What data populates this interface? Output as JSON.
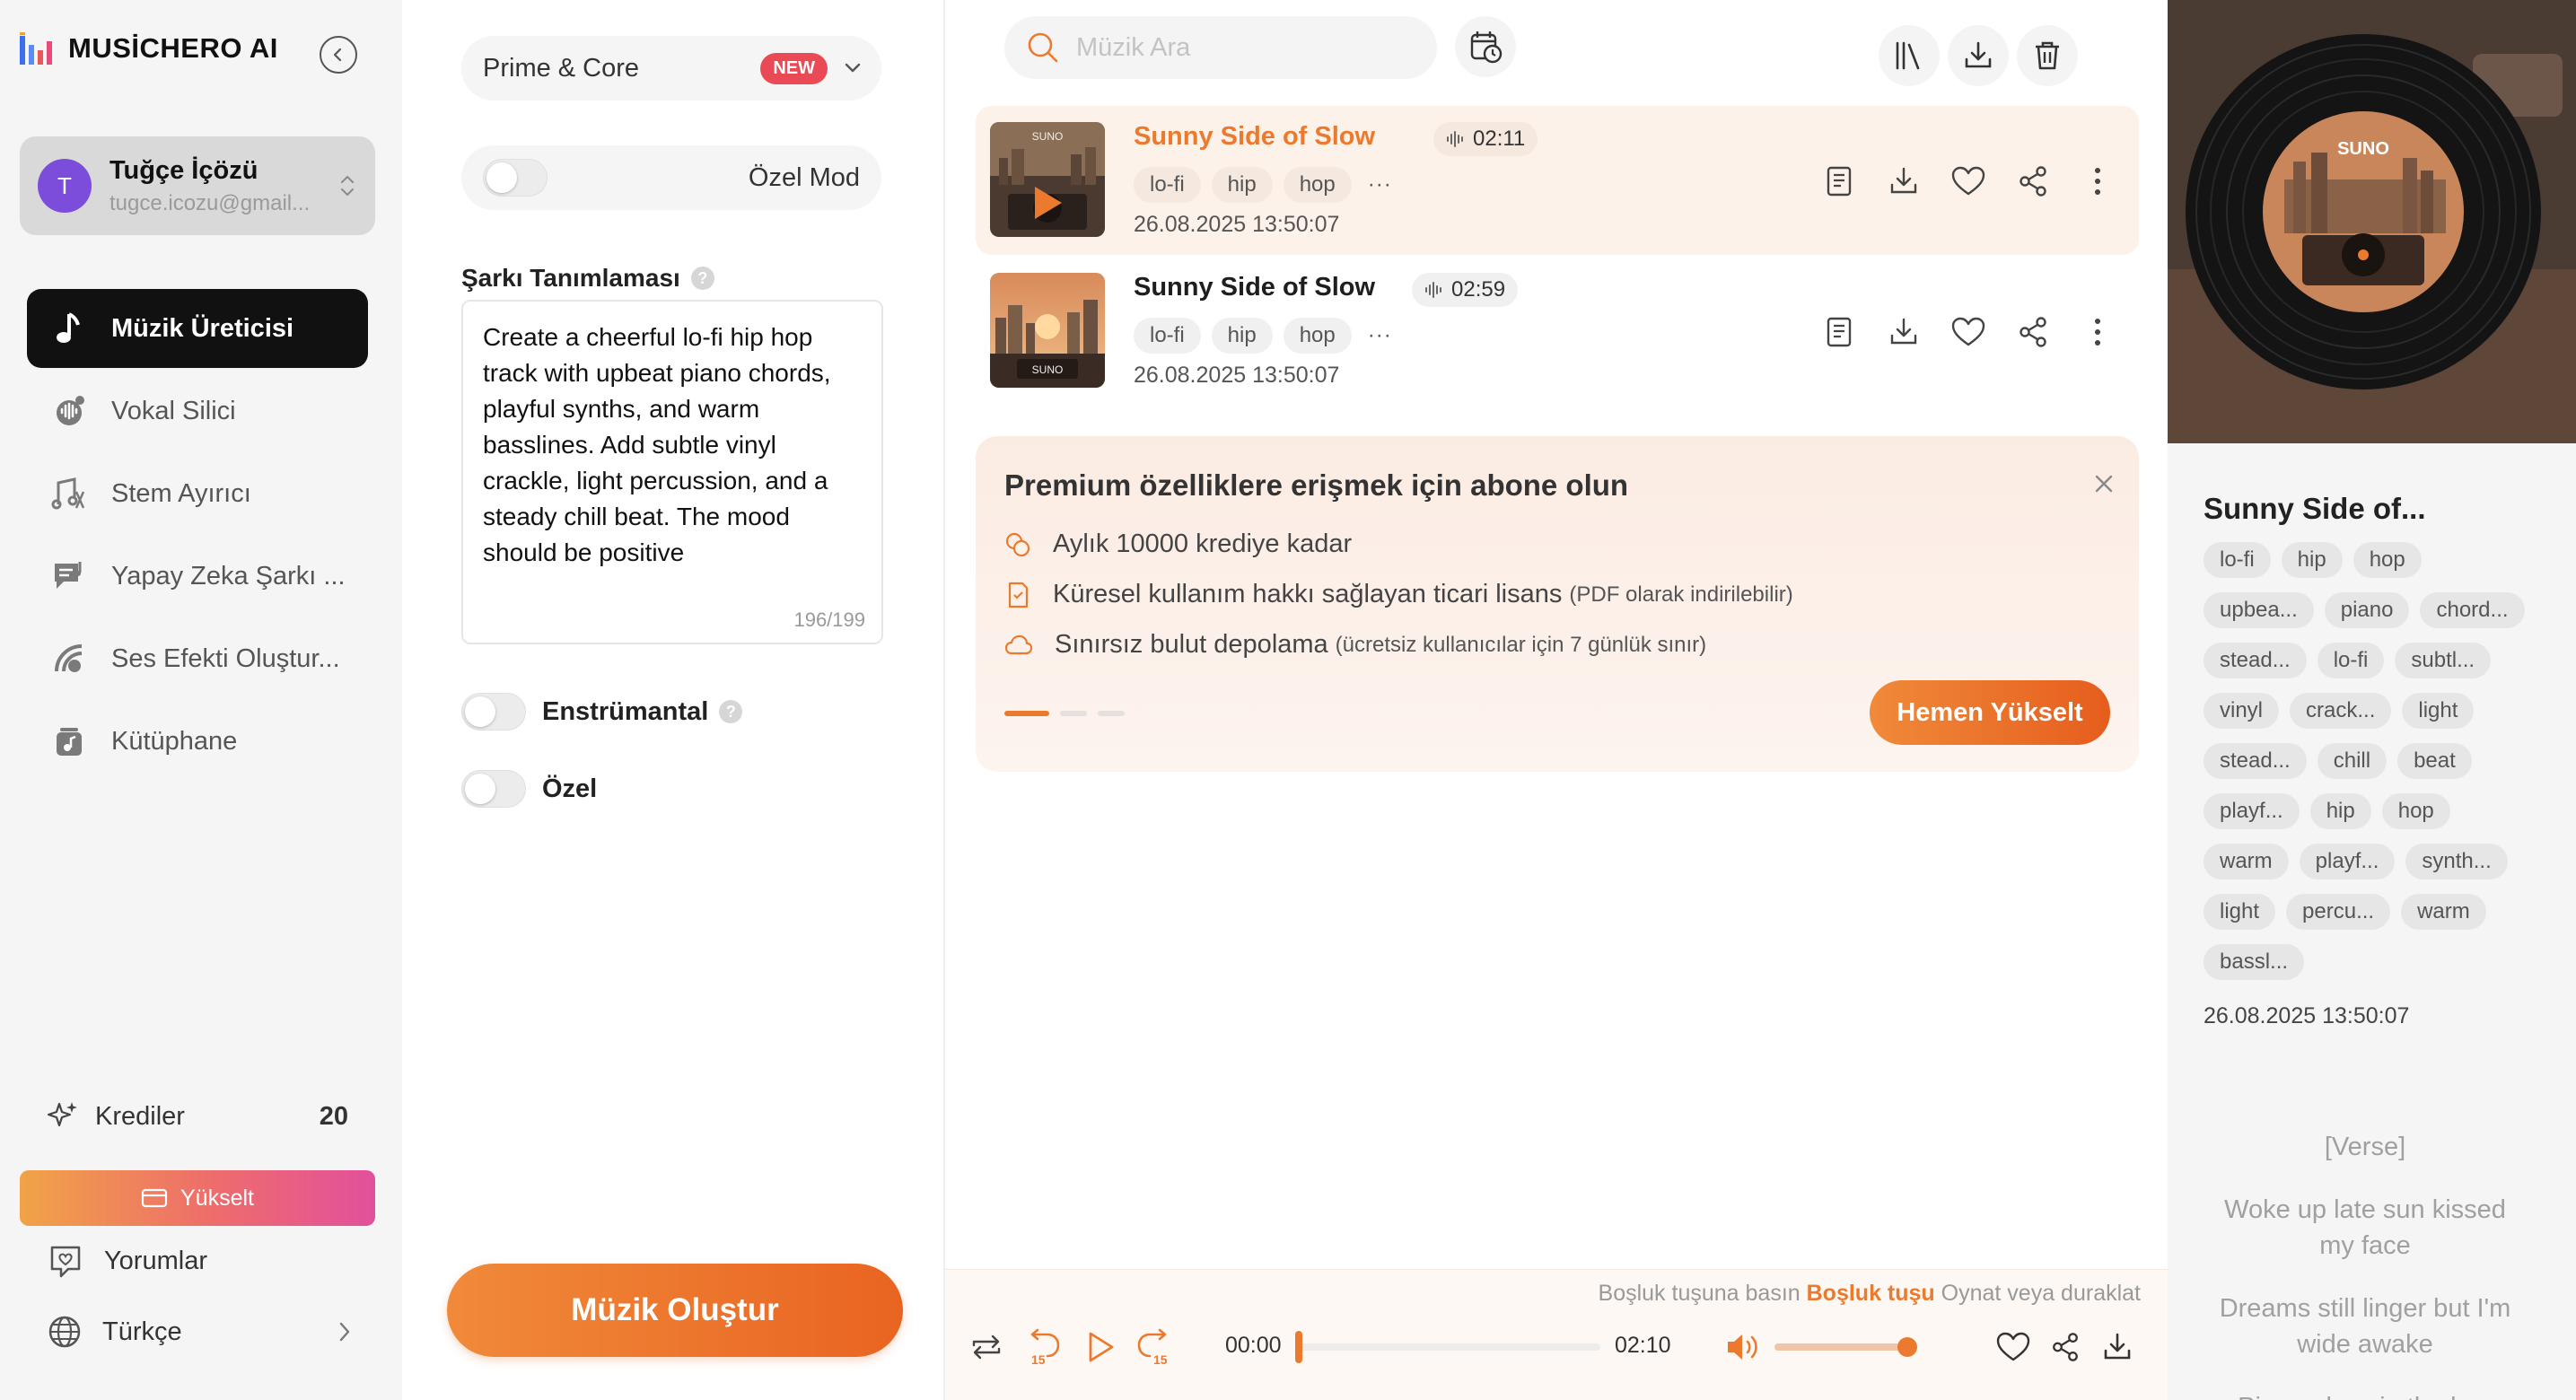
{
  "app": {
    "logo_text": "MUSİCHERO AI",
    "colors": {
      "accent": "#ec7a2e",
      "active_nav": "#111111",
      "badge_new": "#ea4a55"
    }
  },
  "user": {
    "initial": "T",
    "name": "Tuğçe İçözü",
    "email": "tugce.icozu@gmail..."
  },
  "nav": [
    {
      "label": "Müzik Üreticisi",
      "icon": "music-note-icon",
      "active": true
    },
    {
      "label": "Vokal Silici",
      "icon": "vocal-remover-icon",
      "active": false
    },
    {
      "label": "Stem Ayırıcı",
      "icon": "stem-splitter-icon",
      "active": false
    },
    {
      "label": "Yapay Zeka Şarkı ...",
      "icon": "ai-lyrics-icon",
      "active": false
    },
    {
      "label": "Ses Efekti Oluştur...",
      "icon": "sound-effect-icon",
      "active": false
    },
    {
      "label": "Kütüphane",
      "icon": "library-icon",
      "active": false
    }
  ],
  "sidebar_bottom": {
    "credits_label": "Krediler",
    "credits_value": "20",
    "upgrade_label": "Yükselt",
    "feedback_label": "Yorumlar",
    "language_label": "Türkçe"
  },
  "form": {
    "model_label": "Prime & Core",
    "model_badge": "NEW",
    "custom_mode_label": "Özel Mod",
    "description_label": "Şarkı Tanımlaması",
    "description_text": "Create a cheerful lo-fi hip hop track with upbeat piano chords, playful synths, and warm basslines. Add subtle vinyl crackle, light percussion, and a steady chill beat. The mood should be positive",
    "char_count": "196/199",
    "instrumental_label": "Enstrümantal",
    "private_label": "Özel",
    "create_button": "Müzik Oluştur"
  },
  "search": {
    "placeholder": "Müzik Ara"
  },
  "songs": [
    {
      "title": "Sunny Side of Slow",
      "duration": "02:11",
      "tags": [
        "lo-fi",
        "hip",
        "hop"
      ],
      "more": "···",
      "date": "26.08.2025 13:50:07",
      "active": true
    },
    {
      "title": "Sunny Side of Slow",
      "duration": "02:59",
      "tags": [
        "lo-fi",
        "hip",
        "hop"
      ],
      "more": "···",
      "date": "26.08.2025 13:50:07",
      "active": false
    }
  ],
  "cover_label": "SUNO",
  "promo": {
    "title": "Premium özelliklere erişmek için abone olun",
    "items": [
      {
        "text": "Aylık 10000 krediye kadar",
        "note": ""
      },
      {
        "text": "Küresel kullanım hakkı sağlayan ticari lisans",
        "note": "(PDF olarak indirilebilir)"
      },
      {
        "text": "Sınırsız bulut depolama",
        "note": "(ücretsiz kullanıcılar için 7 günlük sınır)"
      }
    ],
    "button": "Hemen Yükselt"
  },
  "player": {
    "hint_prefix": "Boşluk tuşuna basın",
    "hint_key": "Boşluk tuşu",
    "hint_suffix": "Oynat veya duraklat",
    "current_time": "00:00",
    "total_time": "02:10",
    "progress": 0,
    "volume": 1.0,
    "skip_seconds": "15"
  },
  "detail": {
    "title": "Sunny Side of...",
    "tags": [
      "lo-fi",
      "hip",
      "hop",
      "upbea...",
      "piano",
      "chord...",
      "stead...",
      "lo-fi",
      "subtl...",
      "vinyl",
      "crack...",
      "light",
      "stead...",
      "chill",
      "beat",
      "playf...",
      "hip",
      "hop",
      "warm",
      "playf...",
      "synth...",
      "light",
      "percu...",
      "warm",
      "bassl..."
    ],
    "date": "26.08.2025 13:50:07",
    "lyrics": [
      "[Verse]",
      "Woke up late sun kissed my face",
      "Dreams still linger but I'm wide awake",
      "Piano plays in the bac"
    ]
  }
}
